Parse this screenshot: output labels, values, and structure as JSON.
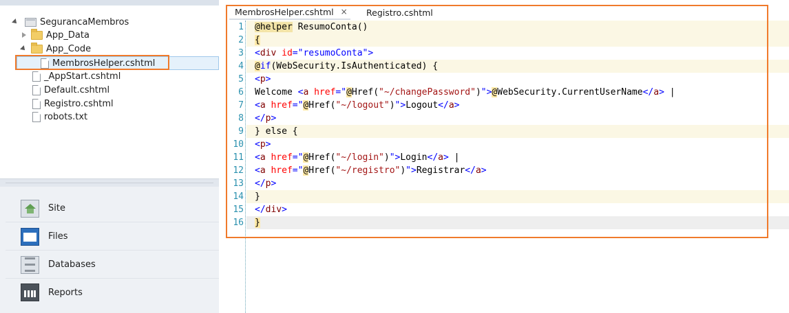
{
  "tree": {
    "project": "SegurancaMembros",
    "items": [
      {
        "label": "App_Data",
        "type": "folder",
        "expanded": false
      },
      {
        "label": "App_Code",
        "type": "folder",
        "expanded": true
      },
      {
        "label": "MembrosHelper.cshtml",
        "type": "file",
        "selected": true
      },
      {
        "label": "_AppStart.cshtml",
        "type": "file"
      },
      {
        "label": "Default.cshtml",
        "type": "file"
      },
      {
        "label": "Registro.cshtml",
        "type": "file"
      },
      {
        "label": "robots.txt",
        "type": "file"
      }
    ]
  },
  "nav": {
    "items": [
      {
        "label": "Site",
        "icon": "site-icon"
      },
      {
        "label": "Files",
        "icon": "files-icon"
      },
      {
        "label": "Databases",
        "icon": "databases-icon"
      },
      {
        "label": "Reports",
        "icon": "reports-icon"
      }
    ]
  },
  "tabs": [
    {
      "label": "MembrosHelper.cshtml",
      "active": true,
      "close": "×"
    },
    {
      "label": "Registro.cshtml",
      "active": false
    }
  ],
  "editor": {
    "line_numbers": [
      "1",
      "2",
      "3",
      "4",
      "5",
      "6",
      "7",
      "8",
      "9",
      "10",
      "11",
      "12",
      "13",
      "14",
      "15",
      "16"
    ],
    "lines": {
      "l1": {
        "at": "@helper",
        "rest": " ResumoConta()"
      },
      "l2": {
        "text": "{"
      },
      "l3": {
        "open": "<",
        "tag": "div",
        "attr": " id",
        "eq": "=",
        "val": "\"resumoConta\"",
        "close": ">"
      },
      "l4": {
        "at": "@",
        "kw": "if",
        "rest": "(WebSecurity.IsAuthenticated) {"
      },
      "l5": {
        "open": "<",
        "tag": "p",
        "close": ">"
      },
      "l6": {
        "pre": "Welcome ",
        "open": "<",
        "tag": "a",
        "attr": " href",
        "eq": "=",
        "q1": "\"",
        "at": "@",
        "fn": "Href(",
        "str": "\"~/changePassword\"",
        "fnclose": ")",
        "q2": "\"",
        "close": ">",
        "at2": "@",
        "expr": "WebSecurity.CurrentUserName",
        "endopen": "</",
        "endtag": "a",
        "endclose": ">",
        "tail": " |"
      },
      "l7": {
        "open": "<",
        "tag": "a",
        "attr": " href",
        "eq": "=",
        "q1": "\"",
        "at": "@",
        "fn": "Href(",
        "str": "\"~/logout\"",
        "fnclose": ")",
        "q2": "\"",
        "close": ">",
        "text": "Logout",
        "endopen": "</",
        "endtag": "a",
        "endclose": ">"
      },
      "l8": {
        "open": "</",
        "tag": "p",
        "close": ">"
      },
      "l9": {
        "text": "} else {"
      },
      "l10": {
        "open": "<",
        "tag": "p",
        "close": ">"
      },
      "l11": {
        "open": "<",
        "tag": "a",
        "attr": " href",
        "eq": "=",
        "q1": "\"",
        "at": "@",
        "fn": "Href(",
        "str": "\"~/login\"",
        "fnclose": ")",
        "q2": "\"",
        "close": ">",
        "text": "Login",
        "endopen": "</",
        "endtag": "a",
        "endclose": ">",
        "tail": " |"
      },
      "l12": {
        "open": "<",
        "tag": "a",
        "attr": " href",
        "eq": "=",
        "q1": "\"",
        "at": "@",
        "fn": "Href(",
        "str": "\"~/registro\"",
        "fnclose": ")",
        "q2": "\"",
        "close": ">",
        "text": "Registrar",
        "endopen": "</",
        "endtag": "a",
        "endclose": ">"
      },
      "l13": {
        "open": "</",
        "tag": "p",
        "close": ">"
      },
      "l14": {
        "text": "}"
      },
      "l15": {
        "open": "</",
        "tag": "div",
        "close": ">"
      },
      "l16": {
        "text": "}"
      }
    }
  },
  "colors": {
    "highlight_border": "#f07a2b",
    "line_number": "#2b91af",
    "html_tag": "#800000",
    "html_attr": "#ff0000",
    "razor_at_bg": "#ffe9a6"
  }
}
